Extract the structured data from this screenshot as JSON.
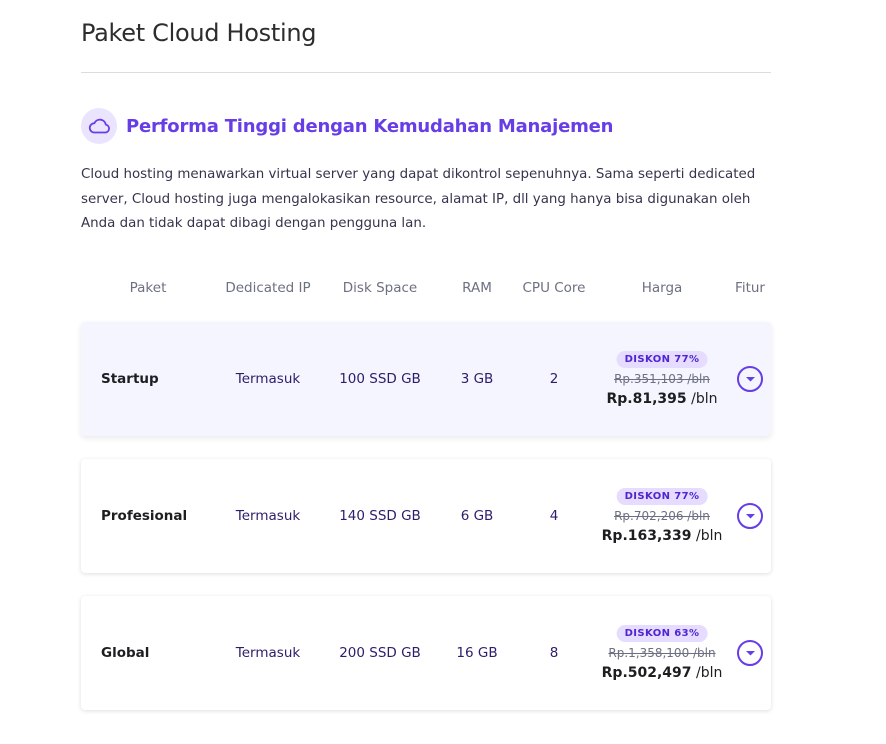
{
  "page_title": "Paket Cloud Hosting",
  "section": {
    "icon": "cloud-icon",
    "title": "Performa Tinggi dengan Kemudahan Manajemen",
    "description": "Cloud hosting menawarkan virtual server yang dapat dikontrol sepenuhnya. Sama seperti dedicated server, Cloud hosting juga mengalokasikan resource, alamat IP, dll yang hanya bisa digunakan oleh Anda dan tidak dapat dibagi dengan pengguna lan."
  },
  "table": {
    "headers": {
      "paket": "Paket",
      "ip": "Dedicated IP",
      "disk": "Disk Space",
      "ram": "RAM",
      "cpu": "CPU Core",
      "harga": "Harga",
      "fitur": "Fitur"
    },
    "rows": [
      {
        "name": "Startup",
        "ip": "Termasuk",
        "disk": "100 SSD GB",
        "ram": "3 GB",
        "cpu": "2",
        "discount": "DISKON 77%",
        "old_price": "Rp.351,103 /bln",
        "price": "Rp.81,395",
        "per": "/bln",
        "highlighted": true
      },
      {
        "name": "Profesional",
        "ip": "Termasuk",
        "disk": "140 SSD GB",
        "ram": "6 GB",
        "cpu": "4",
        "discount": "DISKON 77%",
        "old_price": "Rp.702,206 /bln",
        "price": "Rp.163,339",
        "per": "/bln",
        "highlighted": false
      },
      {
        "name": "Global",
        "ip": "Termasuk",
        "disk": "200 SSD GB",
        "ram": "16 GB",
        "cpu": "8",
        "discount": "DISKON 63%",
        "old_price": "Rp.1,358,100 /bln",
        "price": "Rp.502,497",
        "per": "/bln",
        "highlighted": false
      }
    ],
    "expand_icon": "chevron-down-circle-icon"
  },
  "colors": {
    "accent": "#673de6",
    "badge_bg": "#e5dcff",
    "row_highlight": "#f4f5ff"
  }
}
